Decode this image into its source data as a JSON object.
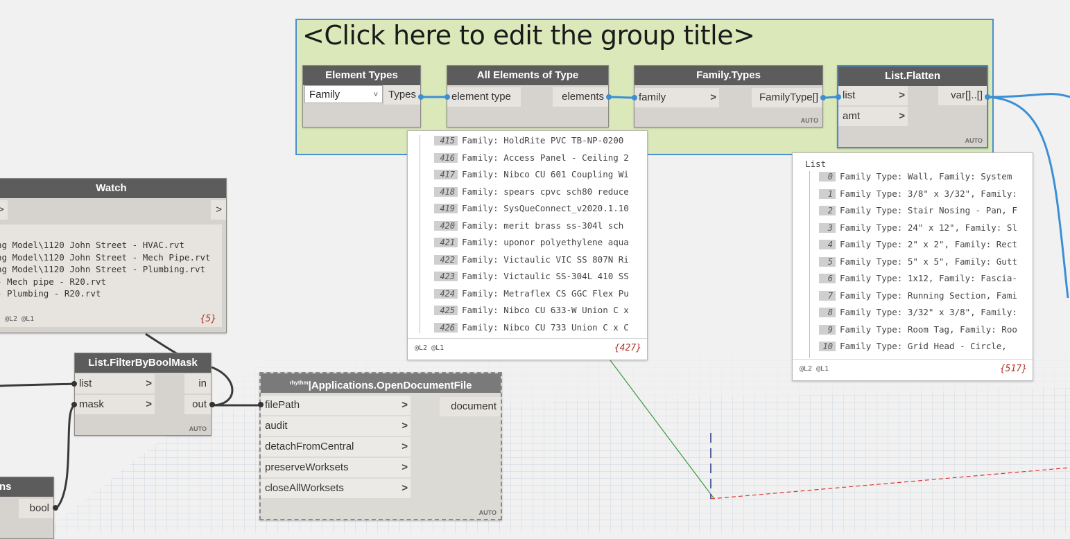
{
  "group": {
    "title": "<Click here to edit the group title>"
  },
  "nodes": {
    "element_types": {
      "title": "Element Types",
      "dropdown_value": "Family",
      "output": "Types"
    },
    "all_elements": {
      "title": "All Elements of Type",
      "input": "element type",
      "output": "elements"
    },
    "family_types": {
      "title": "Family.Types",
      "input": "family",
      "output": "FamilyType[]",
      "auto": "AUTO"
    },
    "list_flatten": {
      "title": "List.Flatten",
      "input1": "list",
      "input2": "amt",
      "output": "var[]..[]",
      "auto": "AUTO"
    },
    "watch": {
      "title": "Watch",
      "lines": [
        "ng Model\\1120 John Street - HVAC.rvt",
        "ng Model\\1120 John Street - Mech Pipe.rvt",
        "ng Model\\1120 John Street - Plumbing.rvt",
        "- Mech pipe - R20.rvt",
        "- Plumbing - R20.rvt"
      ],
      "levels": "@L2 @L1",
      "count": "{5}"
    },
    "filter": {
      "title": "List.FilterByBoolMask",
      "input1": "list",
      "input2": "mask",
      "output1": "in",
      "output2": "out",
      "auto": "AUTO"
    },
    "open_doc": {
      "brand": "rhythm",
      "title": "Applications.OpenDocumentFile",
      "inputs": [
        "filePath",
        "audit",
        "detachFromCentral",
        "preserveWorksets",
        "closeAllWorksets"
      ],
      "output": "document",
      "auto": "AUTO"
    },
    "bool_node": {
      "title": "ns",
      "output": "bool"
    }
  },
  "preview_elements": {
    "rows": [
      {
        "i": "415",
        "t": "Family: HoldRite PVC TB-NP-0200"
      },
      {
        "i": "416",
        "t": "Family: Access Panel - Ceiling 2"
      },
      {
        "i": "417",
        "t": "Family: Nibco CU 601 Coupling Wi"
      },
      {
        "i": "418",
        "t": "Family: spears cpvc sch80 reduce"
      },
      {
        "i": "419",
        "t": "Family: SysQueConnect_v2020.1.10"
      },
      {
        "i": "420",
        "t": "Family: merit brass ss-304l sch"
      },
      {
        "i": "421",
        "t": "Family: uponor polyethylene aqua"
      },
      {
        "i": "422",
        "t": "Family: Victaulic VIC SS 807N Ri"
      },
      {
        "i": "423",
        "t": "Family: Victaulic SS-304L 410 SS"
      },
      {
        "i": "424",
        "t": "Family: Metraflex CS GGC Flex Pu"
      },
      {
        "i": "425",
        "t": "Family: Nibco CU 633-W Union C x"
      },
      {
        "i": "426",
        "t": "Family: Nibco CU 733 Union C x C"
      }
    ],
    "levels": "@L2 @L1",
    "count": "{427}"
  },
  "preview_flatten": {
    "header": "List",
    "rows": [
      {
        "i": "0",
        "t": "Family Type: Wall, Family: System"
      },
      {
        "i": "1",
        "t": "Family Type: 3/8\" x 3/32\", Family:"
      },
      {
        "i": "2",
        "t": "Family Type: Stair Nosing - Pan, F"
      },
      {
        "i": "3",
        "t": "Family Type: 24\" x 12\", Family: Sl"
      },
      {
        "i": "4",
        "t": "Family Type: 2\" x 2\", Family: Rect"
      },
      {
        "i": "5",
        "t": "Family Type: 5\" x 5\", Family: Gutt"
      },
      {
        "i": "6",
        "t": "Family Type: 1x12, Family: Fascia-"
      },
      {
        "i": "7",
        "t": "Family Type: Running Section, Fami"
      },
      {
        "i": "8",
        "t": "Family Type: 3/32\" x 3/8\", Family:"
      },
      {
        "i": "9",
        "t": "Family Type: Room Tag, Family: Roo"
      },
      {
        "i": "10",
        "t": "Family Type: Grid Head - Circle,"
      }
    ],
    "levels": "@L2 @L1",
    "count": "{517}"
  },
  "colors": {
    "group_bg": "#dbe8b9",
    "selection": "#3b8fd6",
    "header": "#5c5c5c",
    "count": "#b2312b"
  }
}
